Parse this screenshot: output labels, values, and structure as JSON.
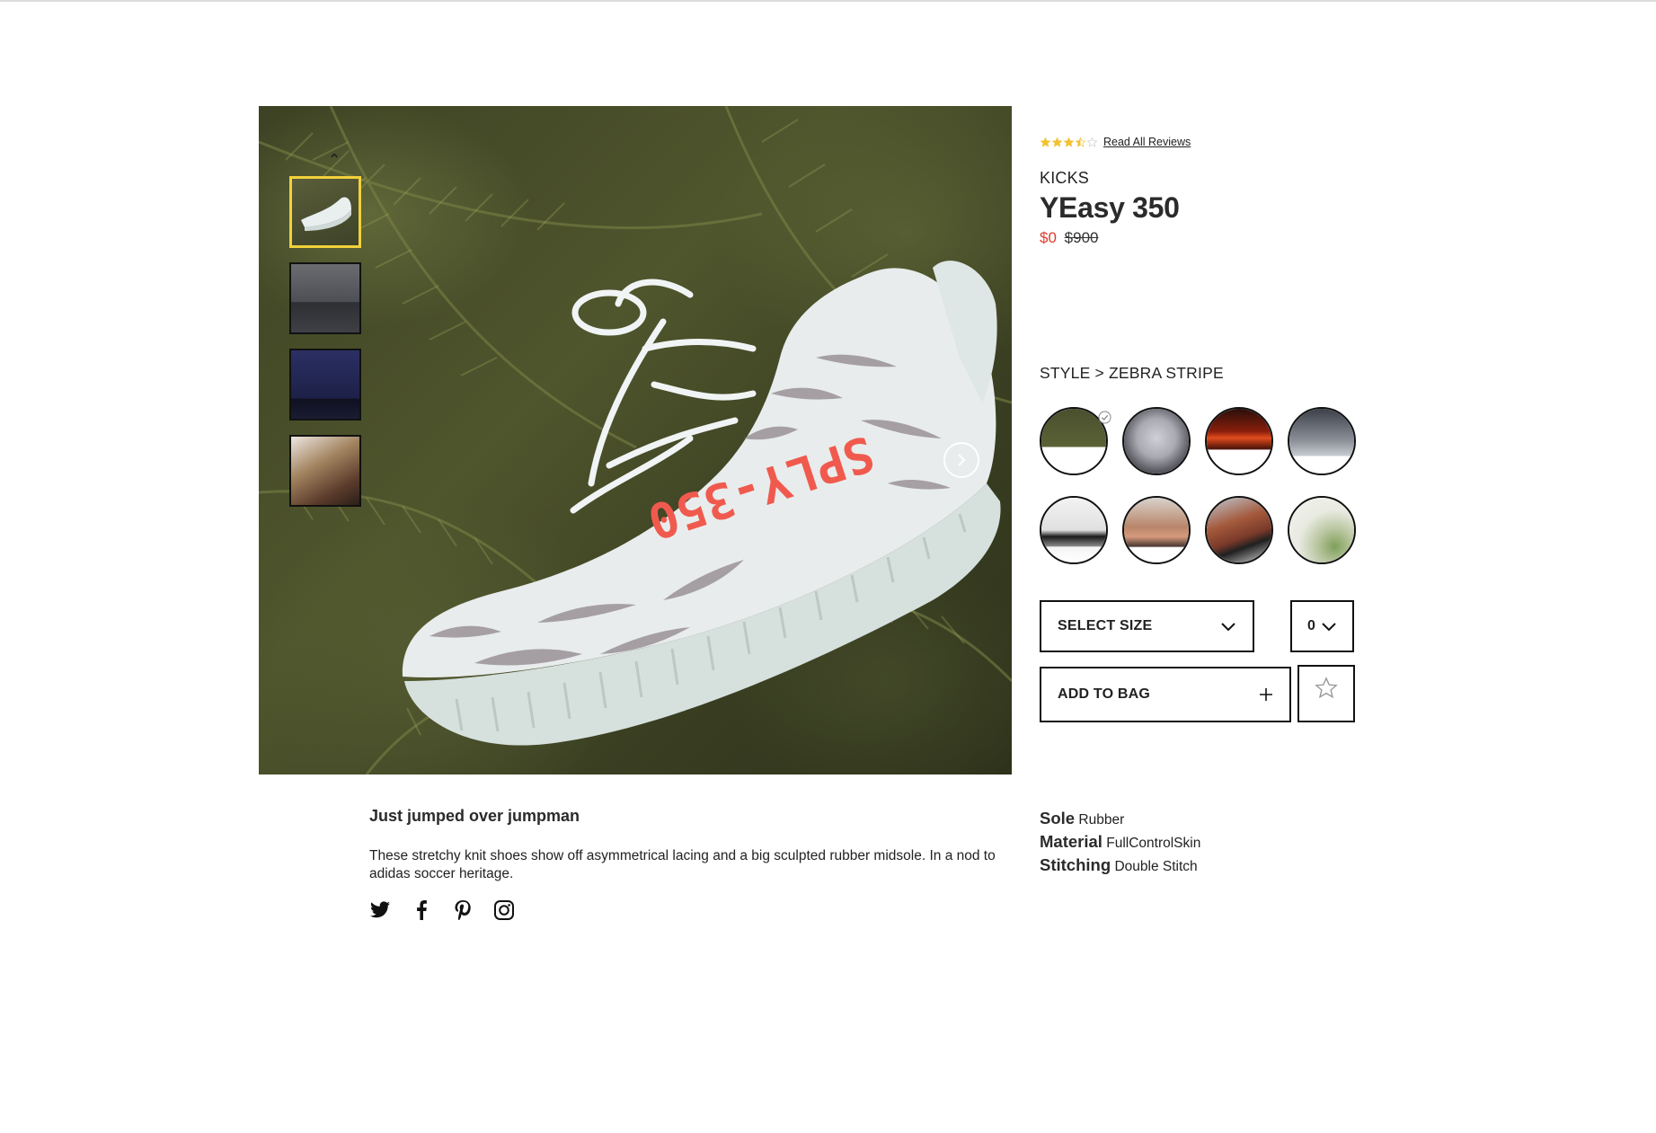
{
  "product": {
    "rating": 3.5,
    "rating_max": 5,
    "reviews_link": "Read All Reviews",
    "brand": "KICKS",
    "title": "YEasy 350",
    "price_now": "$0",
    "price_was": "$900"
  },
  "style": {
    "label": "STYLE > ZEBRA STRIPE",
    "selected_index": 0
  },
  "controls": {
    "select_size": "SELECT SIZE",
    "quantity": "0",
    "add_to_bag": "ADD TO BAG",
    "add_icon": "plus-icon",
    "favorite_icon": "star-outline-icon"
  },
  "description": {
    "title": "Just jumped over jumpman",
    "body": "These stretchy knit shoes show off asymmetrical lacing and a big sculpted rubber midsole. In a nod to adidas soccer heritage."
  },
  "specs": [
    {
      "key": "Sole",
      "value": "Rubber"
    },
    {
      "key": "Material",
      "value": "FullControlSkin"
    },
    {
      "key": "Stitching",
      "value": "Double Stitch"
    }
  ],
  "social": [
    "twitter-icon",
    "facebook-icon",
    "pinterest-icon",
    "instagram-icon"
  ],
  "colors": {
    "sale_price": "#e13a2b",
    "star_fill": "#f2c12e",
    "active_thumb_border": "#f2d13a"
  }
}
